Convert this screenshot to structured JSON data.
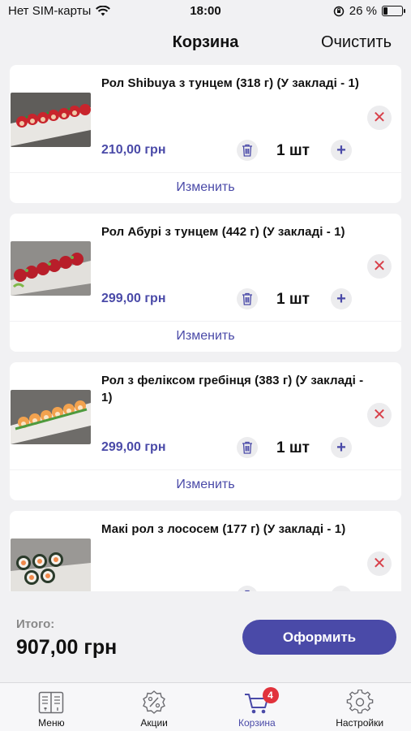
{
  "status_bar": {
    "carrier": "Нет SIM-карты",
    "time": "18:00",
    "battery_percent": "26 %",
    "battery_level": 0.26
  },
  "header": {
    "title": "Корзина",
    "clear_label": "Очистить"
  },
  "cart": {
    "items": [
      {
        "name": "Рол Shibuya з тунцем (318 г) (У закладі - 1)",
        "price": "210,00 грн",
        "quantity": "1 шт",
        "change_label": "Изменить"
      },
      {
        "name": "Рол Абурі з тунцем (442 г) (У закладі - 1)",
        "price": "299,00 грн",
        "quantity": "1 шт",
        "change_label": "Изменить"
      },
      {
        "name": "Рол з феліксом гребінця (383 г) (У закладі - 1)",
        "price": "299,00 грн",
        "quantity": "1 шт",
        "change_label": "Изменить"
      },
      {
        "name": "Макі рол з лососем (177 г) (У закладі - 1)",
        "price": "",
        "quantity": "",
        "change_label": ""
      }
    ]
  },
  "footer": {
    "total_label": "Итого:",
    "total_value": "907,00 грн",
    "checkout_label": "Оформить"
  },
  "tab_bar": {
    "tabs": [
      {
        "label": "Меню",
        "icon": "menu-book-icon"
      },
      {
        "label": "Акции",
        "icon": "percent-badge-icon"
      },
      {
        "label": "Корзина",
        "icon": "cart-icon",
        "badge": "4",
        "active": true
      },
      {
        "label": "Настройки",
        "icon": "gear-icon"
      }
    ]
  },
  "colors": {
    "accent": "#4a4aa8",
    "remove": "#d8404a",
    "badge": "#e1323c",
    "background": "#f1f1f3"
  }
}
